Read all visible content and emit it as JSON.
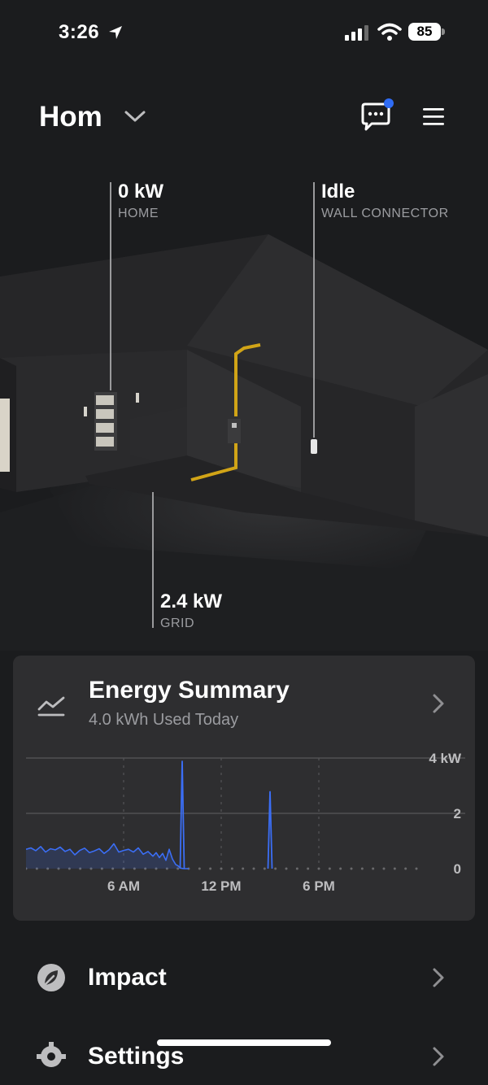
{
  "status_bar": {
    "time": "3:26",
    "battery": "85"
  },
  "header": {
    "site_title": "Hom"
  },
  "flows": {
    "home": {
      "value": "0 kW",
      "label": "HOME"
    },
    "wall_connector": {
      "value": "Idle",
      "label": "WALL CONNECTOR"
    },
    "grid": {
      "value": "2.4 kW",
      "label": "GRID"
    }
  },
  "energy_summary": {
    "title": "Energy Summary",
    "subtitle": "4.0 kWh Used Today"
  },
  "chart_data": {
    "type": "line",
    "xlabel": "",
    "ylabel": "",
    "x_tick_labels": [
      "6 AM",
      "12 PM",
      "6 PM"
    ],
    "y_tick_labels": [
      "4 kW",
      "2",
      "0"
    ],
    "ylim": [
      0,
      4
    ],
    "xlim_hours": [
      0,
      24
    ],
    "grid": true,
    "line_color": "#3b6ef5",
    "series": [
      {
        "x": [
          0,
          0.3,
          0.6,
          0.9,
          1.2,
          1.5,
          1.8,
          2.1,
          2.4,
          2.7,
          3.0,
          3.3,
          3.6,
          3.9,
          4.2,
          4.5,
          4.8,
          5.1,
          5.4,
          5.7,
          6.0,
          6.3,
          6.6,
          6.9,
          7.2,
          7.5,
          7.8,
          8.0,
          8.2,
          8.4,
          8.6,
          8.8,
          9.0,
          9.2,
          9.35,
          9.5,
          9.7,
          10.0,
          12.0,
          14.7,
          14.9,
          15.1,
          15.5,
          18.0
        ],
        "y": [
          0.7,
          0.75,
          0.65,
          0.8,
          0.6,
          0.72,
          0.68,
          0.78,
          0.62,
          0.7,
          0.5,
          0.66,
          0.74,
          0.58,
          0.64,
          0.72,
          0.55,
          0.68,
          0.9,
          0.6,
          0.66,
          0.7,
          0.6,
          0.75,
          0.52,
          0.62,
          0.45,
          0.58,
          0.4,
          0.55,
          0.3,
          0.7,
          0.35,
          0.15,
          0.1,
          0.02,
          0.0,
          0.0,
          0.0,
          0.0,
          0.0,
          2.8,
          0.0,
          0.0
        ]
      }
    ],
    "spikes": [
      {
        "x": 9.6,
        "y": 3.9
      },
      {
        "x": 15.0,
        "y": 2.8
      }
    ]
  },
  "list": {
    "impact": "Impact",
    "settings": "Settings"
  }
}
